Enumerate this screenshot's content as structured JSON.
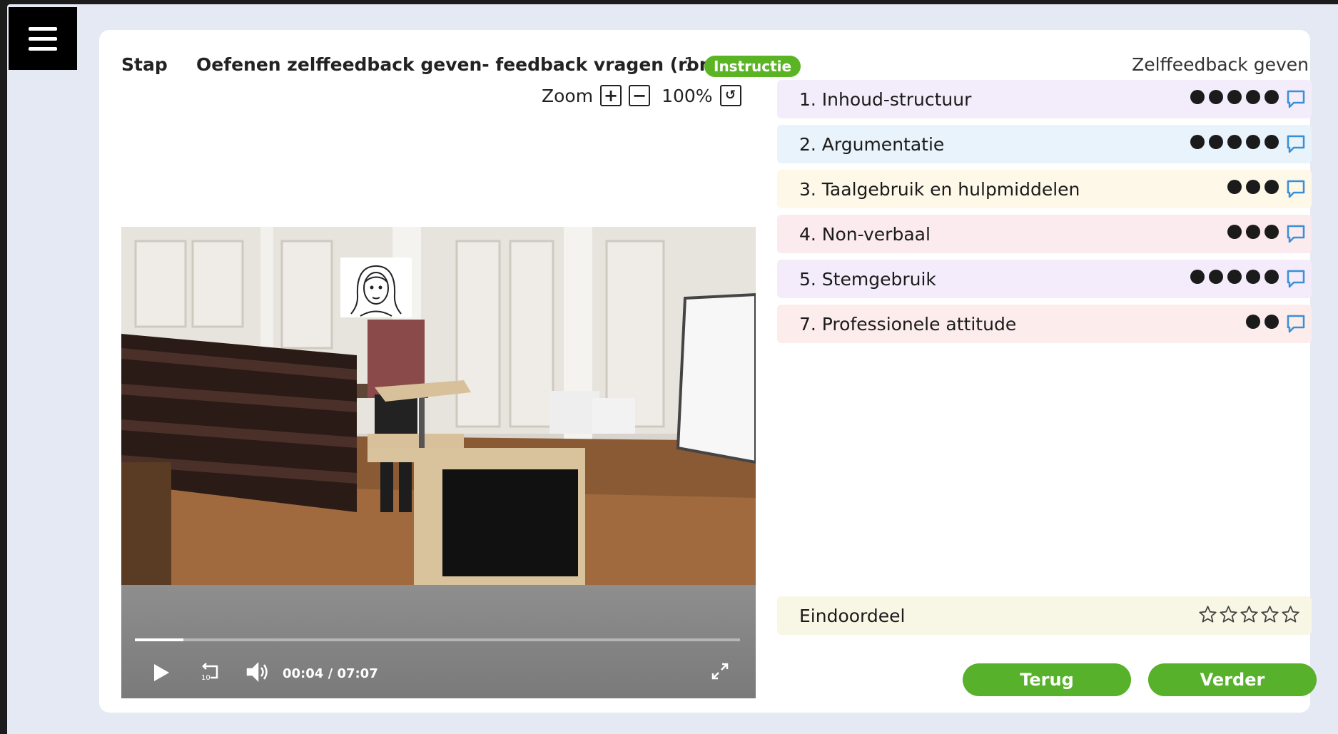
{
  "header": {
    "step_label": "Stap",
    "title": "Oefenen zelffeedback geven- feedback vragen (ronde",
    "round": "1",
    "badge": "Instructie",
    "mode": "Zelffeedback geven"
  },
  "zoom": {
    "label": "Zoom",
    "plus": "+",
    "minus": "−",
    "value": "100%"
  },
  "video": {
    "current_time": "00:04",
    "separator": "/",
    "duration": "07:07",
    "progress": 0.009
  },
  "criteria": [
    {
      "label": "1. Inhoud-structuur",
      "dots": 5,
      "color": "#f3edfb"
    },
    {
      "label": "2. Argumentatie",
      "dots": 5,
      "color": "#e8f3fb"
    },
    {
      "label": "3. Taalgebruik en hulpmiddelen",
      "dots": 3,
      "color": "#fdf8e8"
    },
    {
      "label": "4. Non-verbaal",
      "dots": 3,
      "color": "#fbeaee"
    },
    {
      "label": "5. Stemgebruik",
      "dots": 5,
      "color": "#f4ecfb"
    },
    {
      "label": "7. Professionele attitude",
      "dots": 2,
      "color": "#fcecec"
    }
  ],
  "final": {
    "label": "Eindoordeel",
    "stars_total": 5,
    "stars_filled": 0
  },
  "buttons": {
    "back": "Terug",
    "next": "Verder"
  },
  "colors": {
    "accent_green": "#57b12a",
    "comment_icon_blue": "#3a8fd6"
  }
}
